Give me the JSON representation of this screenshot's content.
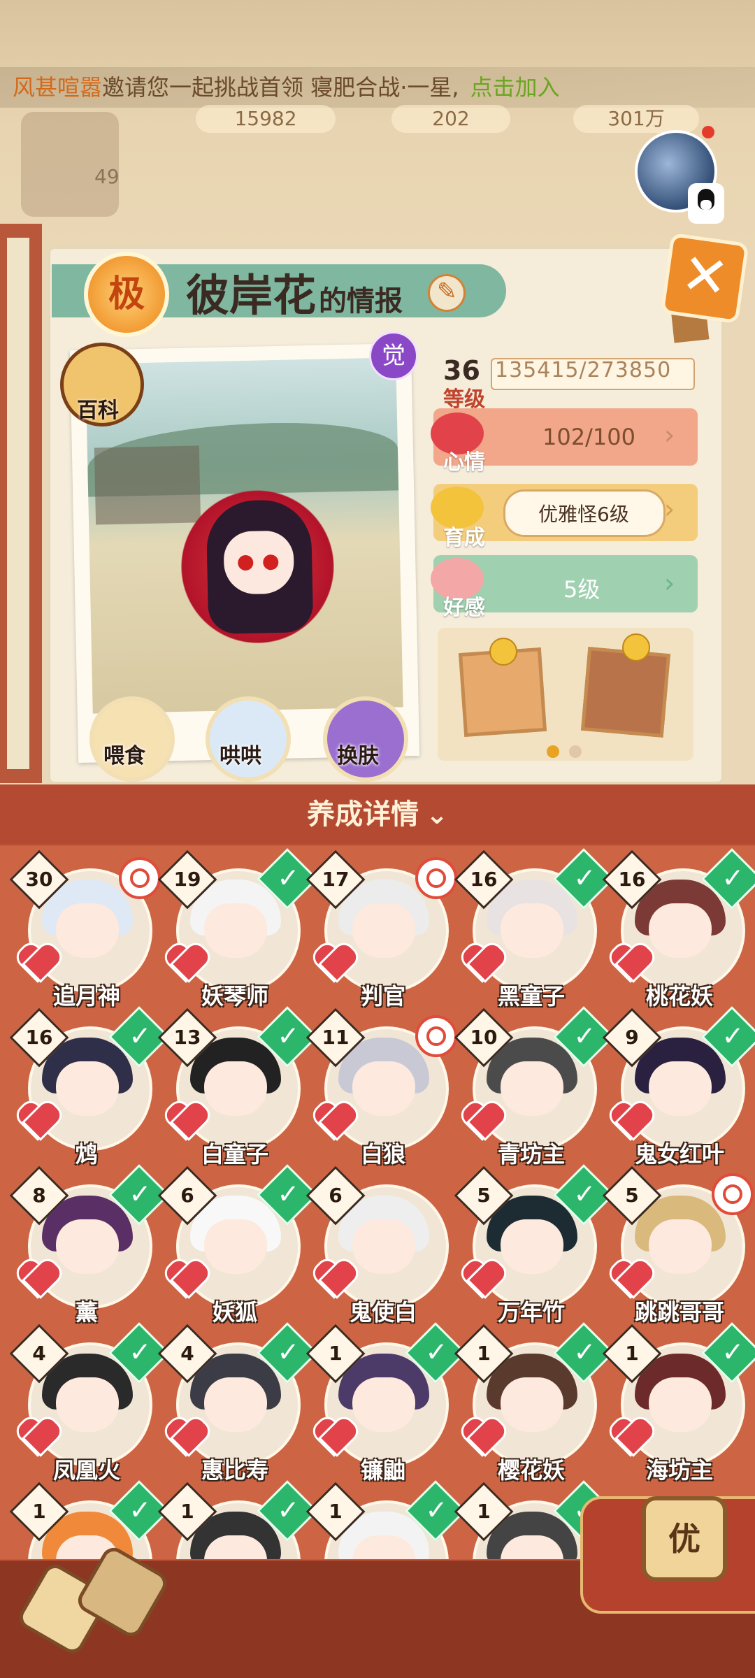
{
  "topbar": {
    "marquee_prefix": "风甚喧嚣",
    "marquee_text": "邀请您一起挑战首领 寝肥合战·一星,",
    "marquee_join": "点击加入",
    "resource_1": "15982",
    "resource_2": "202",
    "resource_3": "301万",
    "player_level": "49"
  },
  "card": {
    "rank_badge": "极",
    "name": "彼岸花",
    "name_suffix": "的情报",
    "awaken_badge": "觉",
    "wiki_label": "百科",
    "actions": [
      {
        "label": "喂食"
      },
      {
        "label": "哄哄"
      },
      {
        "label": "换肤"
      }
    ],
    "level": "36",
    "level_label": "等级",
    "exp_text": "135415/273850",
    "mood_label": "心情",
    "mood_value": "102/100",
    "growth_label": "育成",
    "growth_value": "优雅怪6级",
    "favor_label": "好感",
    "favor_value": "5级"
  },
  "details": {
    "bar_label": "养成详情"
  },
  "roster": [
    {
      "level": "30",
      "name": "追月神",
      "status": "ring"
    },
    {
      "level": "19",
      "name": "妖琴师",
      "status": "check"
    },
    {
      "level": "17",
      "name": "判官",
      "status": "ring"
    },
    {
      "level": "16",
      "name": "黑童子",
      "status": "check"
    },
    {
      "level": "16",
      "name": "桃花妖",
      "status": "check"
    },
    {
      "level": "16",
      "name": "鸩",
      "status": "check"
    },
    {
      "level": "13",
      "name": "白童子",
      "status": "check"
    },
    {
      "level": "11",
      "name": "白狼",
      "status": "ring"
    },
    {
      "level": "10",
      "name": "青坊主",
      "status": "check"
    },
    {
      "level": "9",
      "name": "鬼女红叶",
      "status": "check"
    },
    {
      "level": "8",
      "name": "薰",
      "status": "check"
    },
    {
      "level": "6",
      "name": "妖狐",
      "status": "check"
    },
    {
      "level": "6",
      "name": "鬼使白",
      "status": "none"
    },
    {
      "level": "5",
      "name": "万年竹",
      "status": "check"
    },
    {
      "level": "5",
      "name": "跳跳哥哥",
      "status": "ring"
    },
    {
      "level": "4",
      "name": "凤凰火",
      "status": "check"
    },
    {
      "level": "4",
      "name": "惠比寿",
      "status": "check"
    },
    {
      "level": "1",
      "name": "镰鼬",
      "status": "check"
    },
    {
      "level": "1",
      "name": "樱花妖",
      "status": "check"
    },
    {
      "level": "1",
      "name": "海坊主",
      "status": "check"
    },
    {
      "level": "1",
      "name": "",
      "status": "check"
    },
    {
      "level": "1",
      "name": "",
      "status": "check"
    },
    {
      "level": "1",
      "name": "",
      "status": "check"
    },
    {
      "level": "1",
      "name": "",
      "status": "check"
    }
  ],
  "footer": {
    "priority_label": "优"
  },
  "colors": {
    "accent_orange": "#ee8c2a",
    "ribbon_green": "#7fb7a0",
    "panel_red": "#c9583c",
    "check_green": "#2cb66b",
    "heart_red": "#e2434a"
  }
}
